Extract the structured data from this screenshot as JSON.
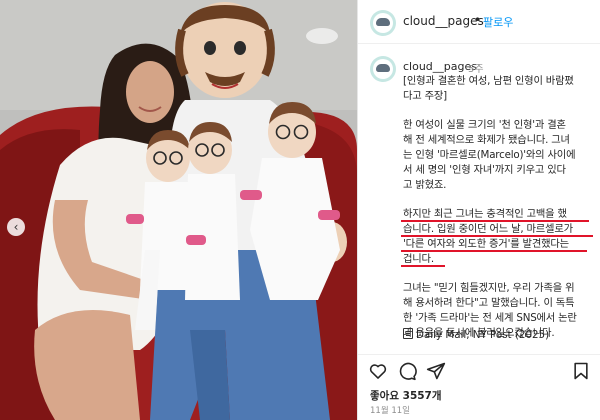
{
  "header": {
    "username": "cloud__pages",
    "dot": "•",
    "follow_label": "팔로우"
  },
  "caption": {
    "username": "cloud__pages",
    "time": "5주",
    "paragraphs": [
      "[인형과 결혼한 여성, 남편 인형이 바람폈\n다고 주장]",
      "한 여성이 실물 크기의 '천 인형'과 결혼\n해 전 세계적으로 화제가 됐습니다. 그녀\n는 인형 '마르셀로(Marcelo)'와의 사이에\n서 세 명의 '인형 자녀'까지 키우고 있다\n고 밝혔죠.",
      "하지만 최근 그녀는 충격적인 고백을 했\n습니다. 입원 중이던 어느 날, 마르셀로가\n'다른 여자와 외도한 증거'를 발견했다는\n겁니다.",
      "그녀는 \"믿기 힘들겠지만, 우리 가족을 위\n해 용서하려 한다\"고 말했습니다. 이 독특\n한 '가족 드라마'는 전 세계 SNS에서 논란\n과 웃음을 동시에 불러일으켰습니다."
    ],
    "source": "Daily Mail, NY Post (2025)"
  },
  "actions": {
    "likes": "좋아요 3557개",
    "date": "11월 11일"
  },
  "icons": {
    "prev": "chevron-left-icon",
    "heart": "heart-icon",
    "comment": "comment-icon",
    "share": "send-icon",
    "save": "bookmark-icon",
    "source": "newspaper-icon"
  },
  "colors": {
    "link": "#0095f6",
    "underline": "#e0142a",
    "muted": "#8e8e8e"
  }
}
